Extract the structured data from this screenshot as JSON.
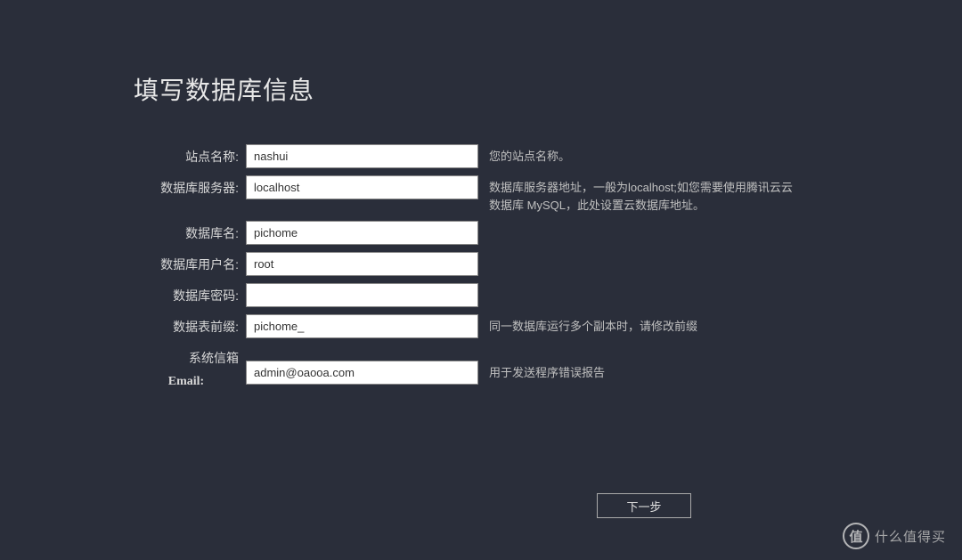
{
  "page": {
    "title": "填写数据库信息"
  },
  "form": {
    "site_name": {
      "label": "站点名称:",
      "value": "nashui",
      "hint": "您的站点名称。"
    },
    "db_server": {
      "label": "数据库服务器:",
      "value": "localhost",
      "hint": "数据库服务器地址，一般为localhost;如您需要使用腾讯云云数据库 MySQL，此处设置云数据库地址。"
    },
    "db_name": {
      "label": "数据库名:",
      "value": "pichome",
      "hint": ""
    },
    "db_user": {
      "label": "数据库用户名:",
      "value": "root",
      "hint": ""
    },
    "db_pass": {
      "label": "数据库密码:",
      "value": "",
      "hint": ""
    },
    "table_prefix": {
      "label": "数据表前缀:",
      "value": "pichome_",
      "hint": "同一数据库运行多个副本时，请修改前缀"
    },
    "sys_mail_top": {
      "label": "系统信箱"
    },
    "sys_mail": {
      "label": "Email:",
      "value": "admin@oaooa.com",
      "hint": "用于发送程序错误报告"
    }
  },
  "actions": {
    "next": "下一步"
  },
  "watermark": {
    "badge": "值",
    "text": "什么值得买"
  }
}
